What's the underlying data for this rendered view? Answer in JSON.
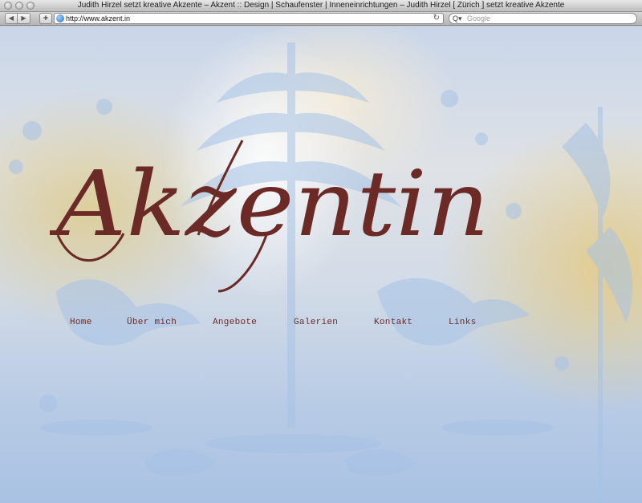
{
  "browser": {
    "window_title": "Judith Hirzel setzt kreative Akzente – Akzent :: Design | Schaufenster | Inneneinrichtungen – Judith Hirzel [ Zürich ] setzt kreative Akzente",
    "back_glyph": "◀",
    "forward_glyph": "▶",
    "add_glyph": "+",
    "url": "http://www.akzent.in",
    "reload_glyph": "↻",
    "search_placeholder": "Google",
    "search_icon_glyph": "Q▾"
  },
  "site": {
    "logo_text": "Akzentin",
    "logo_color": "#6b2a25",
    "nav": [
      {
        "label": "Home"
      },
      {
        "label": "Über mich"
      },
      {
        "label": "Angebote"
      },
      {
        "label": "Galerien"
      },
      {
        "label": "Kontakt"
      },
      {
        "label": "Links"
      }
    ]
  }
}
